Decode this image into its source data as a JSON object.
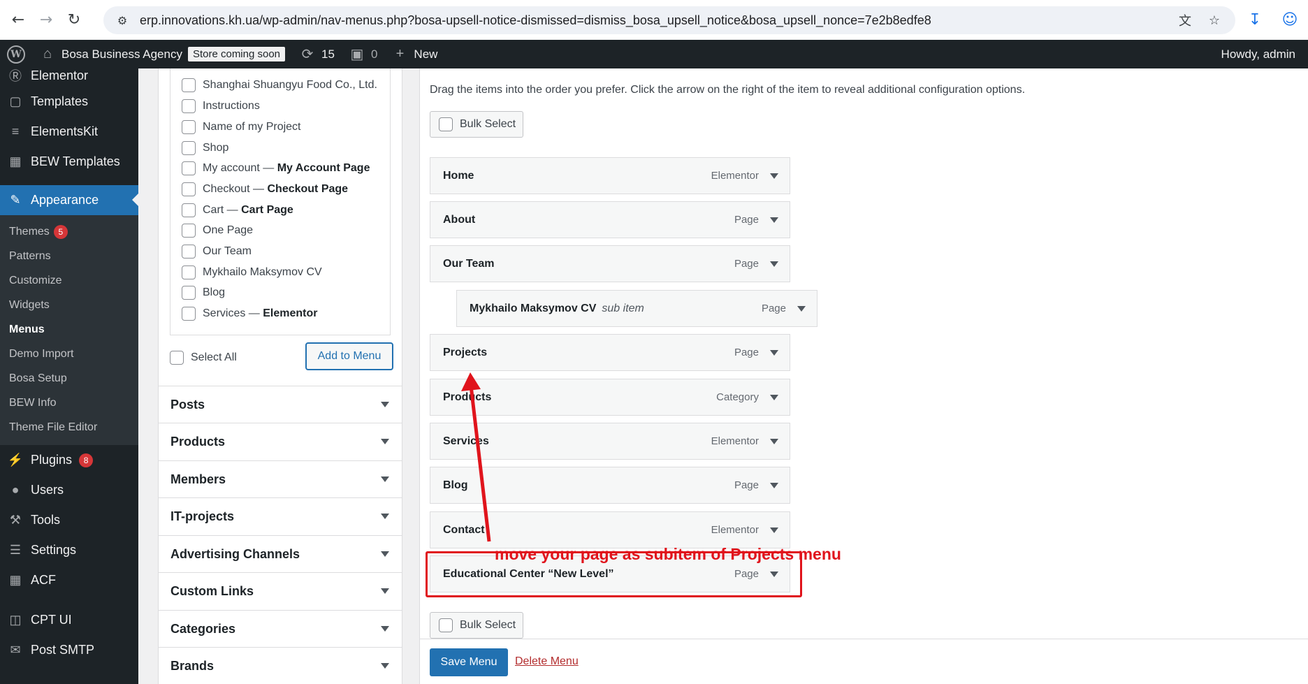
{
  "browser": {
    "url": "erp.innovations.kh.ua/wp-admin/nav-menus.php?bosa-upsell-notice-dismissed=dismiss_bosa_upsell_notice&bosa_upsell_nonce=7e2b8edfe8"
  },
  "admin_bar": {
    "site_name": "Bosa Business Agency",
    "store_badge": "Store coming soon",
    "updates_count": "15",
    "comments_count": "0",
    "new_label": "New",
    "howdy": "Howdy, admin"
  },
  "sidebar": {
    "top_items": [
      {
        "label": "Elementor",
        "icon": "elementor-icon"
      },
      {
        "label": "Templates",
        "icon": "folder-icon"
      },
      {
        "label": "ElementsKit",
        "icon": "elementskit-icon"
      },
      {
        "label": "BEW Templates",
        "icon": "grid-icon"
      }
    ],
    "active_item": {
      "label": "Appearance",
      "icon": "paintbrush-icon"
    },
    "submenu": [
      {
        "label": "Themes",
        "badge": "5"
      },
      {
        "label": "Patterns"
      },
      {
        "label": "Customize"
      },
      {
        "label": "Widgets"
      },
      {
        "label": "Menus"
      },
      {
        "label": "Demo Import"
      },
      {
        "label": "Bosa Setup"
      },
      {
        "label": "BEW Info"
      },
      {
        "label": "Theme File Editor"
      }
    ],
    "bottom_items": [
      {
        "label": "Plugins",
        "icon": "plugin-icon",
        "badge": "8"
      },
      {
        "label": "Users",
        "icon": "users-icon"
      },
      {
        "label": "Tools",
        "icon": "wrench-icon"
      },
      {
        "label": "Settings",
        "icon": "settings-icon"
      },
      {
        "label": "ACF",
        "icon": "acf-icon"
      },
      {
        "label": "CPT UI",
        "icon": "cpt-icon"
      },
      {
        "label": "Post SMTP",
        "icon": "envelope-icon"
      }
    ]
  },
  "left_panel": {
    "pages": [
      {
        "label": "Shanghai Shuangyu Food Co., Ltd.",
        "suffix": ""
      },
      {
        "label": "Instructions",
        "suffix": ""
      },
      {
        "label": "Name of my Project",
        "suffix": ""
      },
      {
        "label": "Shop",
        "suffix": ""
      },
      {
        "label": "My account — ",
        "suffix": "My Account Page"
      },
      {
        "label": "Checkout — ",
        "suffix": "Checkout Page"
      },
      {
        "label": "Cart — ",
        "suffix": "Cart Page"
      },
      {
        "label": "One Page",
        "suffix": ""
      },
      {
        "label": "Our Team",
        "suffix": ""
      },
      {
        "label": "Mykhailo Maksymov CV",
        "suffix": ""
      },
      {
        "label": "Blog",
        "suffix": ""
      },
      {
        "label": "Services — ",
        "suffix": "Elementor"
      }
    ],
    "select_all": "Select All",
    "add_to_menu": "Add to Menu",
    "accordions": [
      "Posts",
      "Products",
      "Members",
      "IT-projects",
      "Advertising Channels",
      "Custom Links",
      "Categories",
      "Brands"
    ]
  },
  "menu_structure": {
    "instructions": "Drag the items into the order you prefer. Click the arrow on the right of the item to reveal additional configuration options.",
    "bulk_select": "Bulk Select",
    "items": [
      {
        "title": "Home",
        "type": "Elementor",
        "sub": ""
      },
      {
        "title": "About",
        "type": "Page",
        "sub": ""
      },
      {
        "title": "Our Team",
        "type": "Page",
        "sub": ""
      },
      {
        "title": "Mykhailo Maksymov CV",
        "type": "Page",
        "sub": "sub item"
      },
      {
        "title": "Projects",
        "type": "Page",
        "sub": ""
      },
      {
        "title": "Products",
        "type": "Category",
        "sub": ""
      },
      {
        "title": "Services",
        "type": "Elementor",
        "sub": ""
      },
      {
        "title": "Blog",
        "type": "Page",
        "sub": ""
      },
      {
        "title": "Contact",
        "type": "Elementor",
        "sub": ""
      },
      {
        "title": "Educational Center “New Level”",
        "type": "Page",
        "sub": ""
      }
    ],
    "save_menu": "Save Menu",
    "delete_menu": "Delete Menu"
  },
  "annotation": {
    "text": "move your page as subitem of Projects menu",
    "color": "#e0141c"
  }
}
